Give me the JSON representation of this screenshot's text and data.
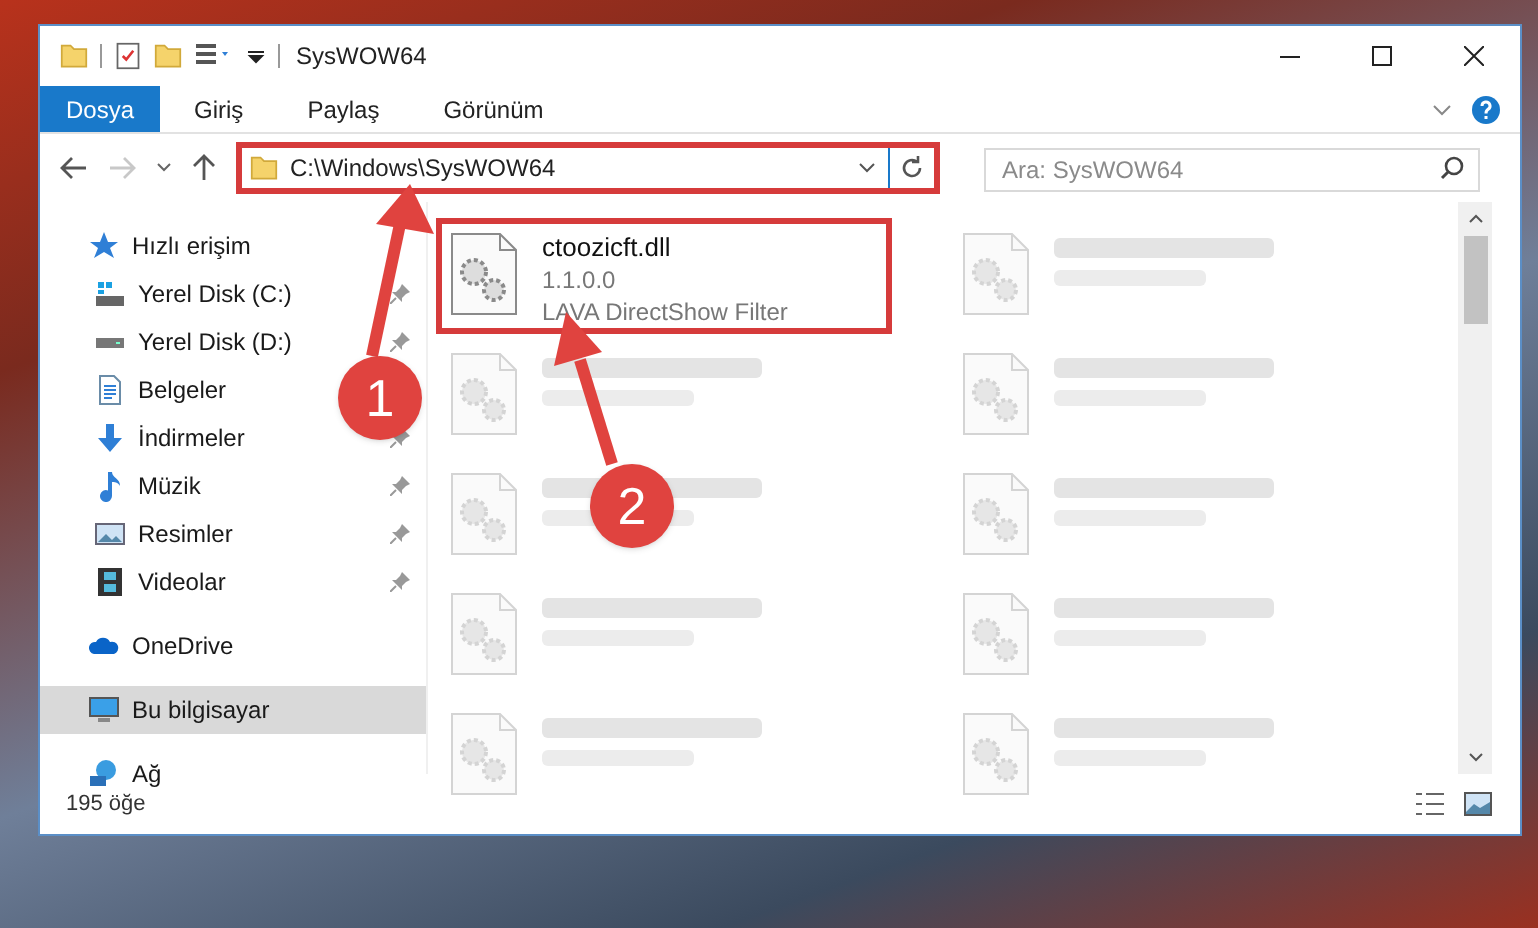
{
  "window": {
    "title": "SysWOW64"
  },
  "ribbon_tabs": [
    {
      "label": "Dosya",
      "selected": true
    },
    {
      "label": "Giriş",
      "selected": false
    },
    {
      "label": "Paylaş",
      "selected": false
    },
    {
      "label": "Görünüm",
      "selected": false
    }
  ],
  "navigation": {
    "forward_disabled": true
  },
  "address": {
    "path": "C:\\Windows\\SysWOW64",
    "highlighted": true
  },
  "search": {
    "placeholder": "Ara: SysWOW64"
  },
  "sidebar": {
    "items": [
      {
        "label": "Hızlı erişim",
        "kind": "star",
        "selected": false,
        "children": [
          {
            "label": "Yerel Disk (C:)",
            "kind": "system-drive",
            "pinned": true,
            "selected": false
          },
          {
            "label": "Yerel Disk (D:)",
            "kind": "drive",
            "pinned": true,
            "selected": false
          },
          {
            "label": "Belgeler",
            "kind": "document",
            "selected": false
          },
          {
            "label": "İndirmeler",
            "kind": "download",
            "pinned": true,
            "selected": false
          },
          {
            "label": "Müzik",
            "kind": "music",
            "pinned": true,
            "selected": false
          },
          {
            "label": "Resimler",
            "kind": "pictures",
            "pinned": true,
            "selected": false
          },
          {
            "label": "Videolar",
            "kind": "videos",
            "pinned": true,
            "selected": false
          }
        ]
      },
      {
        "label": "OneDrive",
        "kind": "cloud",
        "selected": false
      },
      {
        "label": "Bu bilgisayar",
        "kind": "computer",
        "selected": true
      },
      {
        "label": "Ağ",
        "kind": "network",
        "selected": false
      }
    ]
  },
  "files": [
    {
      "kind": "file",
      "name": "ctoozicft.dll",
      "version": "1.1.0.0",
      "description": "LAVA DirectShow Filter",
      "highlighted": true
    },
    {
      "kind": "blurred",
      "highlighted": false
    },
    {
      "kind": "blurred",
      "highlighted": false
    },
    {
      "kind": "blurred",
      "highlighted": false
    },
    {
      "kind": "blurred",
      "highlighted": false
    },
    {
      "kind": "blurred",
      "highlighted": false
    },
    {
      "kind": "blurred",
      "highlighted": false
    },
    {
      "kind": "blurred",
      "highlighted": false
    },
    {
      "kind": "blurred",
      "highlighted": false
    },
    {
      "kind": "blurred",
      "highlighted": false
    }
  ],
  "status_bar": {
    "item_count": "195 öğe"
  },
  "annotations": [
    {
      "label": "1"
    },
    {
      "label": "2"
    }
  ]
}
